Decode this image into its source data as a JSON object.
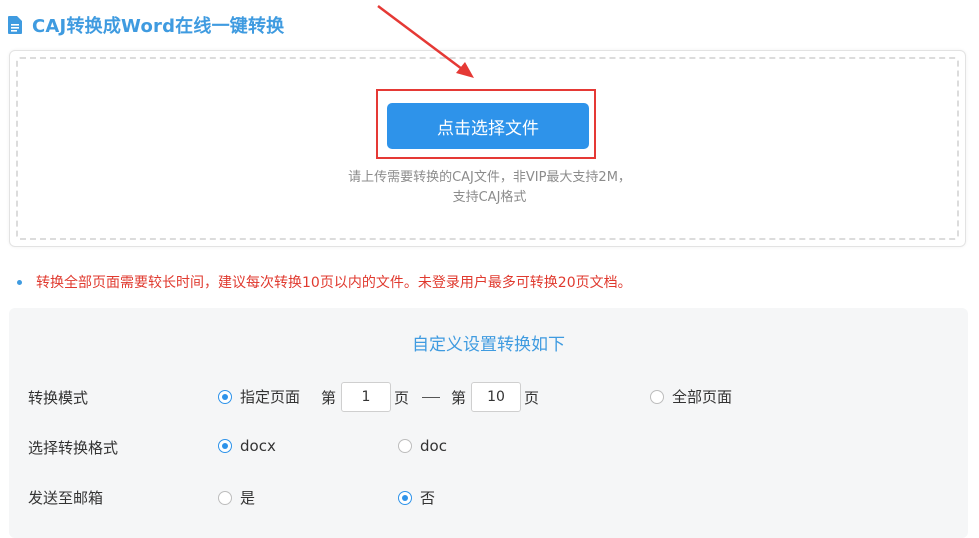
{
  "header": {
    "title": "CAJ转换成Word在线一键转换",
    "icon": "document-icon"
  },
  "upload": {
    "button_label": "点击选择文件",
    "hint_line1": "请上传需要转换的CAJ文件，非VIP最大支持2M，",
    "hint_line2": "支持CAJ格式"
  },
  "notice": "转换全部页面需要较长时间，建议每次转换10页以内的文件。未登录用户最多可转换20页文档。",
  "settings": {
    "title": "自定义设置转换如下",
    "mode": {
      "label": "转换模式",
      "option_range": "指定页面",
      "from_prefix": "第",
      "from_value": "1",
      "from_suffix": "页",
      "to_prefix": "第",
      "to_value": "10",
      "to_suffix": "页",
      "option_all": "全部页面",
      "selected": "指定页面"
    },
    "format": {
      "label": "选择转换格式",
      "option_docx": "docx",
      "option_doc": "doc",
      "selected": "docx"
    },
    "email": {
      "label": "发送至邮箱",
      "option_yes": "是",
      "option_no": "否",
      "selected": "否"
    }
  },
  "colors": {
    "accent": "#3f9be0",
    "button": "#2e93ea",
    "highlight": "#e53935",
    "notice": "#e03a2f"
  }
}
